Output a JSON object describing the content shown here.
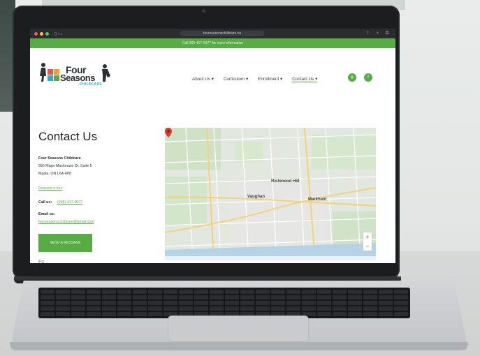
{
  "browser": {
    "url": "fourseasonschildcare.ca",
    "icons": [
      "traffic-lights",
      "sidebar-icon",
      "shield-icon",
      "share-icon",
      "new-tab-icon",
      "tabs-icon"
    ]
  },
  "promo_banner": "Call 905-417-0077 for more information",
  "brand": {
    "line1": "Four",
    "line2": "Seasons",
    "sub": "CHILDCARE",
    "accent": "#57ac44"
  },
  "nav": {
    "items": [
      {
        "label": "About Us ▾"
      },
      {
        "label": "Curriculum ▾"
      },
      {
        "label": "Enrollment ▾"
      },
      {
        "label": "Contact Us ▾"
      }
    ],
    "social": [
      "instagram-icon",
      "facebook-icon"
    ]
  },
  "contact": {
    "title": "Contact Us",
    "name": "Four Seasons Childcare",
    "address1": "955 Major Mackenzie Dr, Suite 5",
    "address2": "Maple, ON L6A 4P8",
    "tour_link": "Request a tour",
    "call_label": "Call us:",
    "phone": "(905) 417-0077",
    "email_label": "Email us:",
    "email": "fourseasonschildcare@gmail.com",
    "cta": "SEND A MESSAGE",
    "partial_text": "Fo"
  },
  "map": {
    "labels": [
      "Richmond Hill",
      "Vaughan",
      "Markham"
    ],
    "zoom_in": "+",
    "zoom_out": "−"
  }
}
